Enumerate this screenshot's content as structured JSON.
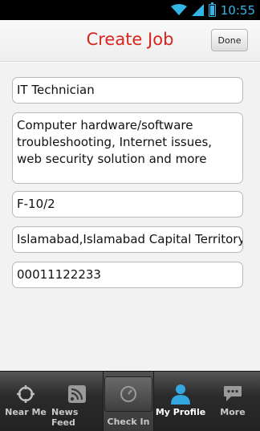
{
  "status_bar": {
    "time": "10:55"
  },
  "header": {
    "title": "Create Job",
    "done_label": "Done"
  },
  "form": {
    "job_title": "IT Technician",
    "description": "Computer hardware/software troubleshooting, Internet issues, web security solution and more",
    "sector": "F-10/2",
    "city": "Islamabad,Islamabad Capital Territory",
    "phone": "00011122233"
  },
  "tabs": [
    {
      "label": "Near Me",
      "icon": "crosshair-icon"
    },
    {
      "label": "News Feed",
      "icon": "rss-icon"
    },
    {
      "label": "Check In",
      "icon": "compass-icon"
    },
    {
      "label": "My Profile",
      "icon": "person-icon",
      "active": true
    },
    {
      "label": "More",
      "icon": "chat-bubble-icon"
    }
  ],
  "colors": {
    "accent_title": "#d9251c",
    "status_accent": "#33b5e5",
    "tab_bar": "#2b2b2b"
  }
}
